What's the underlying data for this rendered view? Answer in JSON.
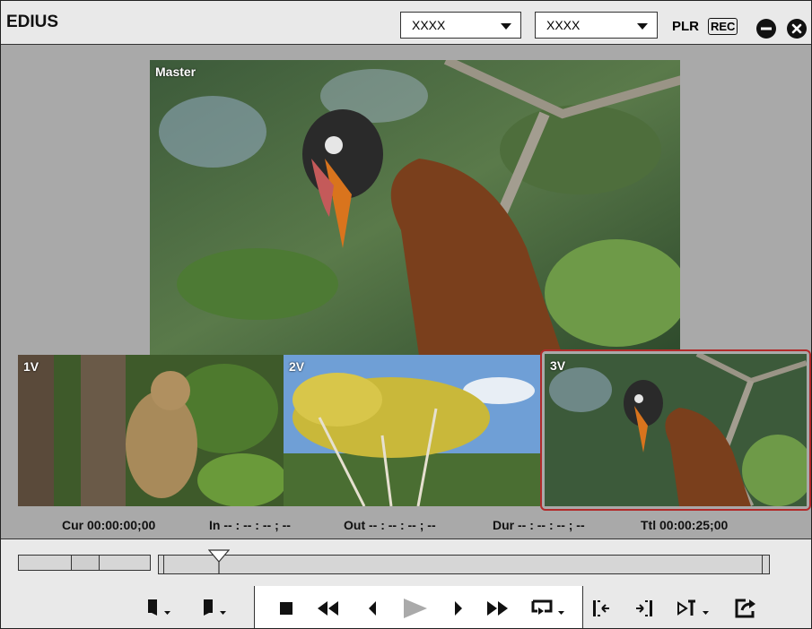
{
  "app": {
    "title": "EDIUS"
  },
  "header": {
    "select1": "XXXX",
    "select2": "XXXX",
    "plr": "PLR",
    "rec": "REC"
  },
  "previews": {
    "master_label": "Master",
    "v1_label": "1V",
    "v2_label": "2V",
    "v3_label": "3V"
  },
  "timecodes": {
    "cur": "Cur 00:00:00;00",
    "in": "In -- : -- : -- ; --",
    "out": "Out -- : -- : -- ; --",
    "dur": "Dur -- : -- : -- ; --",
    "ttl": "Ttl 00:00:25;00"
  },
  "colors": {
    "selected_border": "#b22a2a",
    "background": "#a9a9a9",
    "panel": "#e9e9e9"
  }
}
